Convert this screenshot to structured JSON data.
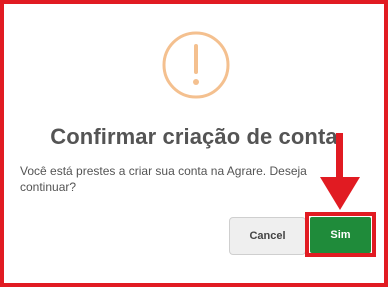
{
  "dialog": {
    "icon": "warning-exclamation-icon",
    "title": "Confirmar criação de conta",
    "message": "Você está prestes a criar sua conta na Agrare. Deseja continuar?",
    "cancel_label": "Cancel",
    "confirm_label": "Sim"
  },
  "colors": {
    "annotation_red": "#e11b22",
    "icon_orange": "#f4c08f",
    "confirm_green": "#1f8b3a",
    "title_gray": "#545454"
  },
  "annotations": {
    "arrow_icon": "down-arrow-icon"
  }
}
